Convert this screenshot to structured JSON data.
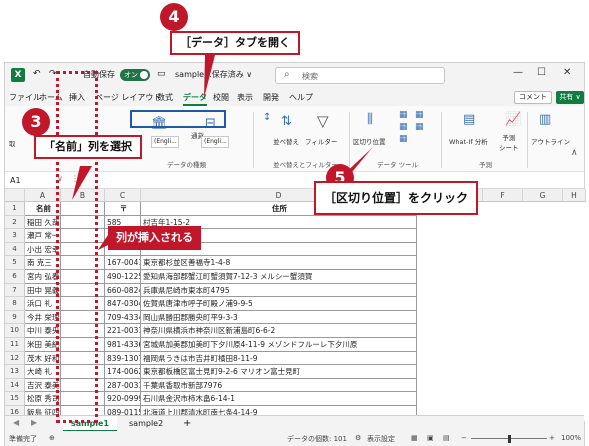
{
  "titlebar": {
    "autosave_label": "自動保存",
    "autosave_state": "オン",
    "filename": "sample...保存済み ∨",
    "search_placeholder": "検索"
  },
  "menu": {
    "tabs": [
      "ファイル",
      "ホーム",
      "挿入",
      "ページ レイアウト",
      "数式",
      "データ",
      "校閲",
      "表示",
      "開発",
      "ヘルプ"
    ],
    "active": "データ",
    "comment": "コメント",
    "share": "共有 ∨"
  },
  "ribbon": {
    "get_label": "取",
    "english1": "(Engli...",
    "english2": "(Engli...",
    "tsuka": "通貨",
    "data_types_group": "データの種類",
    "sort": "並べ替え",
    "filter": "フィルター",
    "sort_filter_group": "並べ替えとフィルター",
    "text_to_columns": "区切り位置",
    "data_tools_group": "データ ツール",
    "whatif": "What-If 分析",
    "forecast": "予測\nシート",
    "forecast_group": "予測",
    "outline": "アウトライン"
  },
  "formula_bar": {
    "name_box": "A1"
  },
  "grid": {
    "columns": [
      "A",
      "B",
      "C",
      "D",
      "E",
      "F",
      "G",
      "H"
    ],
    "header_row": {
      "a": "名前",
      "b": "",
      "c": "〒",
      "d": "住所"
    },
    "rows": [
      {
        "n": "2",
        "a": "稲田 久哉",
        "c": "585",
        "d": "村吉年1-15-2"
      },
      {
        "n": "3",
        "a": "瀬戸 常一",
        "c": "16",
        "d": ""
      },
      {
        "n": "4",
        "a": "小出 宏幸",
        "c": "",
        "d": ""
      },
      {
        "n": "5",
        "a": "南 克三",
        "c": "167-0041",
        "d": "東京都杉並区善福寺1-4-8"
      },
      {
        "n": "6",
        "a": "宮内 弘春",
        "c": "490-1225",
        "d": "愛知県海部郡蟹江町蟹須賀7-12-3 メルシー蟹須賀"
      },
      {
        "n": "7",
        "a": "田中 晃義",
        "c": "660-0824",
        "d": "兵庫県尼崎市東本町4795"
      },
      {
        "n": "8",
        "a": "浜口 礼",
        "c": "847-0304",
        "d": "佐賀県唐津市呼子町殿ノ浦9-9-5"
      },
      {
        "n": "9",
        "a": "今井 栄理",
        "c": "709-4334",
        "d": "岡山県勝田郡勝央町平9-3-3"
      },
      {
        "n": "10",
        "a": "中川 泰央",
        "c": "221-0031",
        "d": "神奈川県横浜市神奈川区新浦島町6-6-2"
      },
      {
        "n": "11",
        "a": "米田 美紀",
        "c": "981-4336",
        "d": "宮城県加美郡加美町下夕川原4-11-9 メゾンドフルーレ下夕川原"
      },
      {
        "n": "12",
        "a": "茂木 好和",
        "c": "839-1307",
        "d": "福岡県うきは市吉井町橘田8-11-9"
      },
      {
        "n": "13",
        "a": "大崎 礼",
        "c": "174-0062",
        "d": "東京都板橋区富士見町9-2-6 マリオン富士見町"
      },
      {
        "n": "14",
        "a": "吉沢 泰美",
        "c": "287-0031",
        "d": "千葉県香取市新部7976"
      },
      {
        "n": "15",
        "a": "松原 秀司",
        "c": "920-0999",
        "d": "石川県金沢市柿木畠6-14-1"
      },
      {
        "n": "16",
        "a": "飯島 征四郎",
        "c": "089-0115",
        "d": "北海道上川郡清水町南七条4-14-9"
      },
      {
        "n": "17",
        "a": "富田 真樹",
        "c": "286-0211",
        "d": "千葉県富里市御料3-10-2"
      }
    ]
  },
  "sheets": {
    "tabs": [
      "sample1",
      "sample2"
    ],
    "active": "sample1",
    "add": "+"
  },
  "statusbar": {
    "ready": "準備完了",
    "count": "データの個数: 101",
    "display_settings": "表示設定",
    "zoom": "100%"
  },
  "callouts": {
    "step3_num": "3",
    "step3_text": "「名前」列を選択",
    "step4_num": "4",
    "step4_text": "［データ］タブを開く",
    "step5_num": "5",
    "step5_text": "［区切り位置］をクリック",
    "inserted_text": "列が挿入される"
  },
  "colors": {
    "accent": "#107c41",
    "callout_red": "#c0182a",
    "highlight_blue": "#1e5aa8"
  }
}
